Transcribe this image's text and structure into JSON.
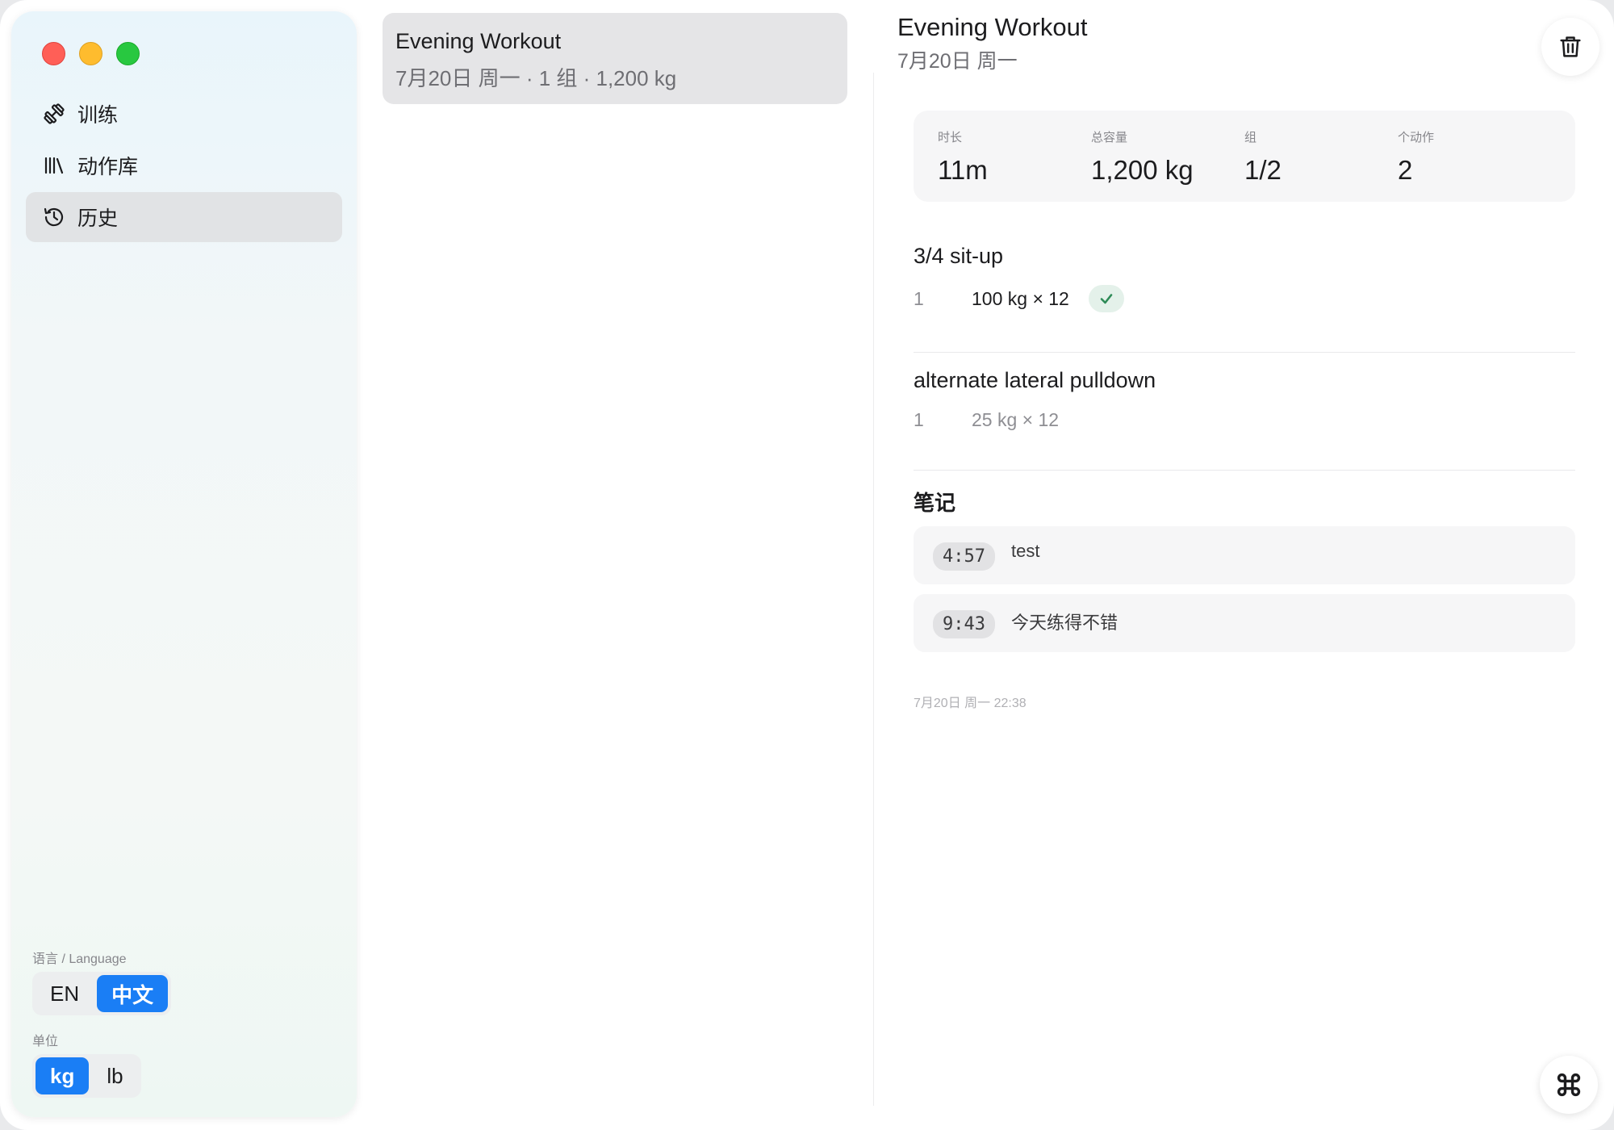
{
  "sidebar": {
    "nav": [
      {
        "label": "训练",
        "icon": "dumbbell-icon",
        "active": false
      },
      {
        "label": "动作库",
        "icon": "library-icon",
        "active": false
      },
      {
        "label": "历史",
        "icon": "history-icon",
        "active": true
      }
    ],
    "language_label": "语言 / Language",
    "language_options": [
      "EN",
      "中文"
    ],
    "language_selected": "中文",
    "unit_label": "单位",
    "unit_options": [
      "kg",
      "lb"
    ],
    "unit_selected": "kg"
  },
  "list": {
    "items": [
      {
        "title": "Evening Workout",
        "subtitle": "7月20日 周一 · 1 组 · 1,200 kg"
      }
    ]
  },
  "detail": {
    "title": "Evening Workout",
    "date": "7月20日 周一",
    "stats": [
      {
        "label": "时长",
        "value": "11m"
      },
      {
        "label": "总容量",
        "value": "1,200 kg"
      },
      {
        "label": "组",
        "value": "1/2"
      },
      {
        "label": "个动作",
        "value": "2"
      }
    ],
    "exercises": [
      {
        "name": "3/4 sit-up",
        "sets": [
          {
            "num": "1",
            "value": "100 kg × 12",
            "done": true
          }
        ]
      },
      {
        "name": "alternate lateral pulldown",
        "sets": [
          {
            "num": "1",
            "value": "25 kg × 12",
            "done": false
          }
        ]
      }
    ],
    "notes_title": "笔记",
    "notes": [
      {
        "time": "4:57",
        "text": "test"
      },
      {
        "time": "9:43",
        "text": "今天练得不错"
      }
    ],
    "footer_date": "7月20日 周一 22:38"
  },
  "colors": {
    "accent": "#1a7ef5",
    "check": "#2e8b57",
    "active_nav": "#e1e3e5"
  }
}
